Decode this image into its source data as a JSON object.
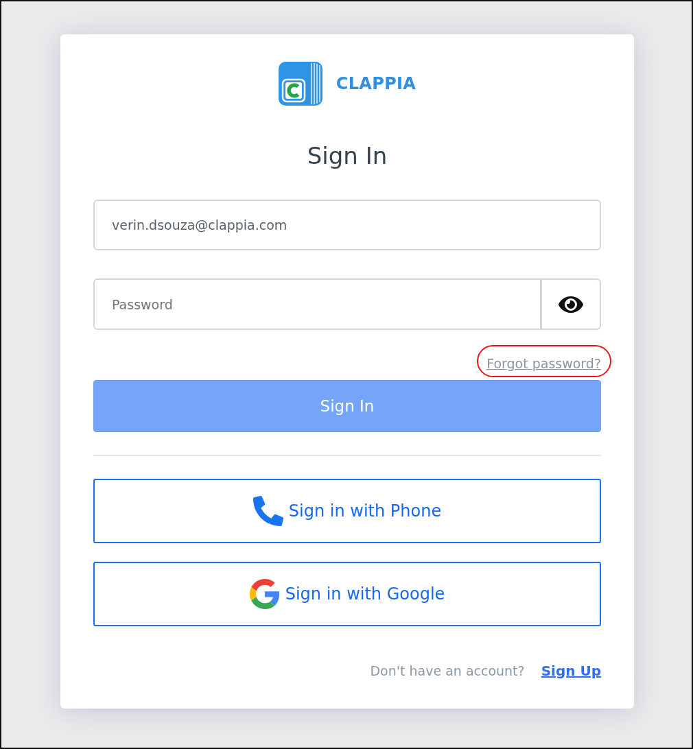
{
  "logo": {
    "brand": "CLAPPIA"
  },
  "title": "Sign In",
  "email_field": {
    "value": "verin.dsouza@clappia.com"
  },
  "password_field": {
    "placeholder": "Password"
  },
  "forgot_password": {
    "label": "Forgot password?",
    "highlighted": true
  },
  "sign_in_button": {
    "label": "Sign In"
  },
  "alt_sign_in": [
    {
      "kind": "phone",
      "label": "Sign in with Phone"
    },
    {
      "kind": "google",
      "label": "Sign in with Google"
    }
  ],
  "footer": {
    "prompt": "Don't have an account?",
    "link": "Sign Up"
  }
}
